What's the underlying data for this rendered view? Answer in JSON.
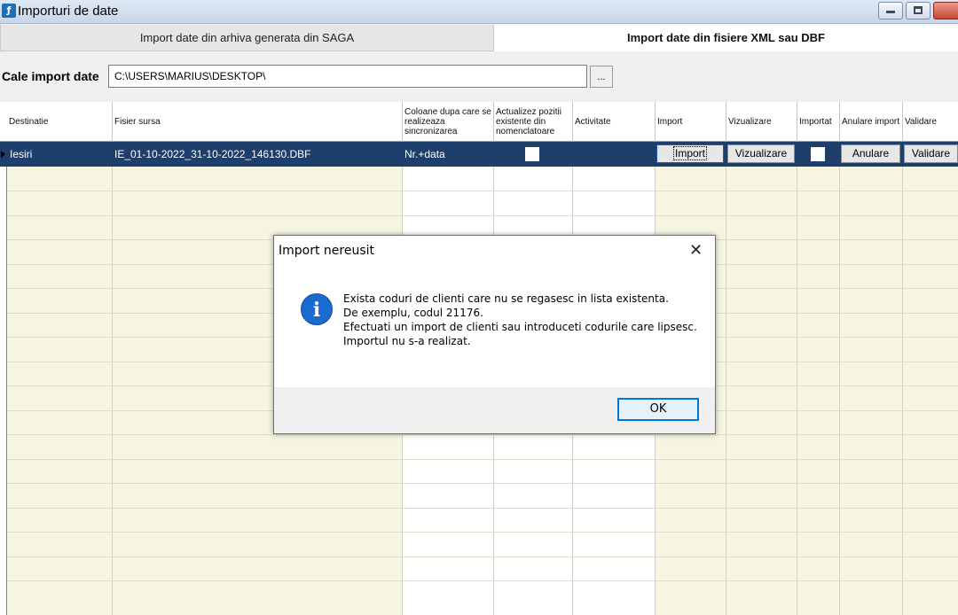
{
  "window": {
    "title": "Importuri de date"
  },
  "tabs": [
    {
      "label": "Import date din arhiva generata din SAGA"
    },
    {
      "label": "Import date din fisiere XML sau DBF"
    }
  ],
  "path": {
    "label": "Cale import date",
    "value": "C:\\USERS\\MARIUS\\DESKTOP\\",
    "browse_label": "..."
  },
  "grid": {
    "headers": {
      "destinatie": "Destinatie",
      "fisier": "Fisier sursa",
      "coloane": "Coloane dupa care se realizeaza sincronizarea",
      "actualizez": "Actualizez pozitii existente din nomenclatoare",
      "activitate": "Activitate",
      "import": "Import",
      "vizualizare": "Vizualizare",
      "importat": "Importat",
      "anulare": "Anulare import",
      "validare": "Validare"
    },
    "row": {
      "destinatie": "Iesiri",
      "fisier": "IE_01-10-2022_31-10-2022_146130.DBF",
      "coloane": "Nr.+data",
      "import_btn": "Import",
      "vizualizare_btn": "Vizualizare",
      "anulare_btn": "Anulare",
      "validare_btn": "Validare"
    }
  },
  "dialog": {
    "title": "Import nereusit",
    "close": "✕",
    "icon": "i",
    "lines": [
      "Exista coduri de clienti care nu se regasesc in lista existenta.",
      "De exemplu, codul 21176.",
      "Efectuati un import de clienti sau introduceti codurile care lipsesc.",
      "Importul nu s-a realizat."
    ],
    "ok": "OK"
  }
}
